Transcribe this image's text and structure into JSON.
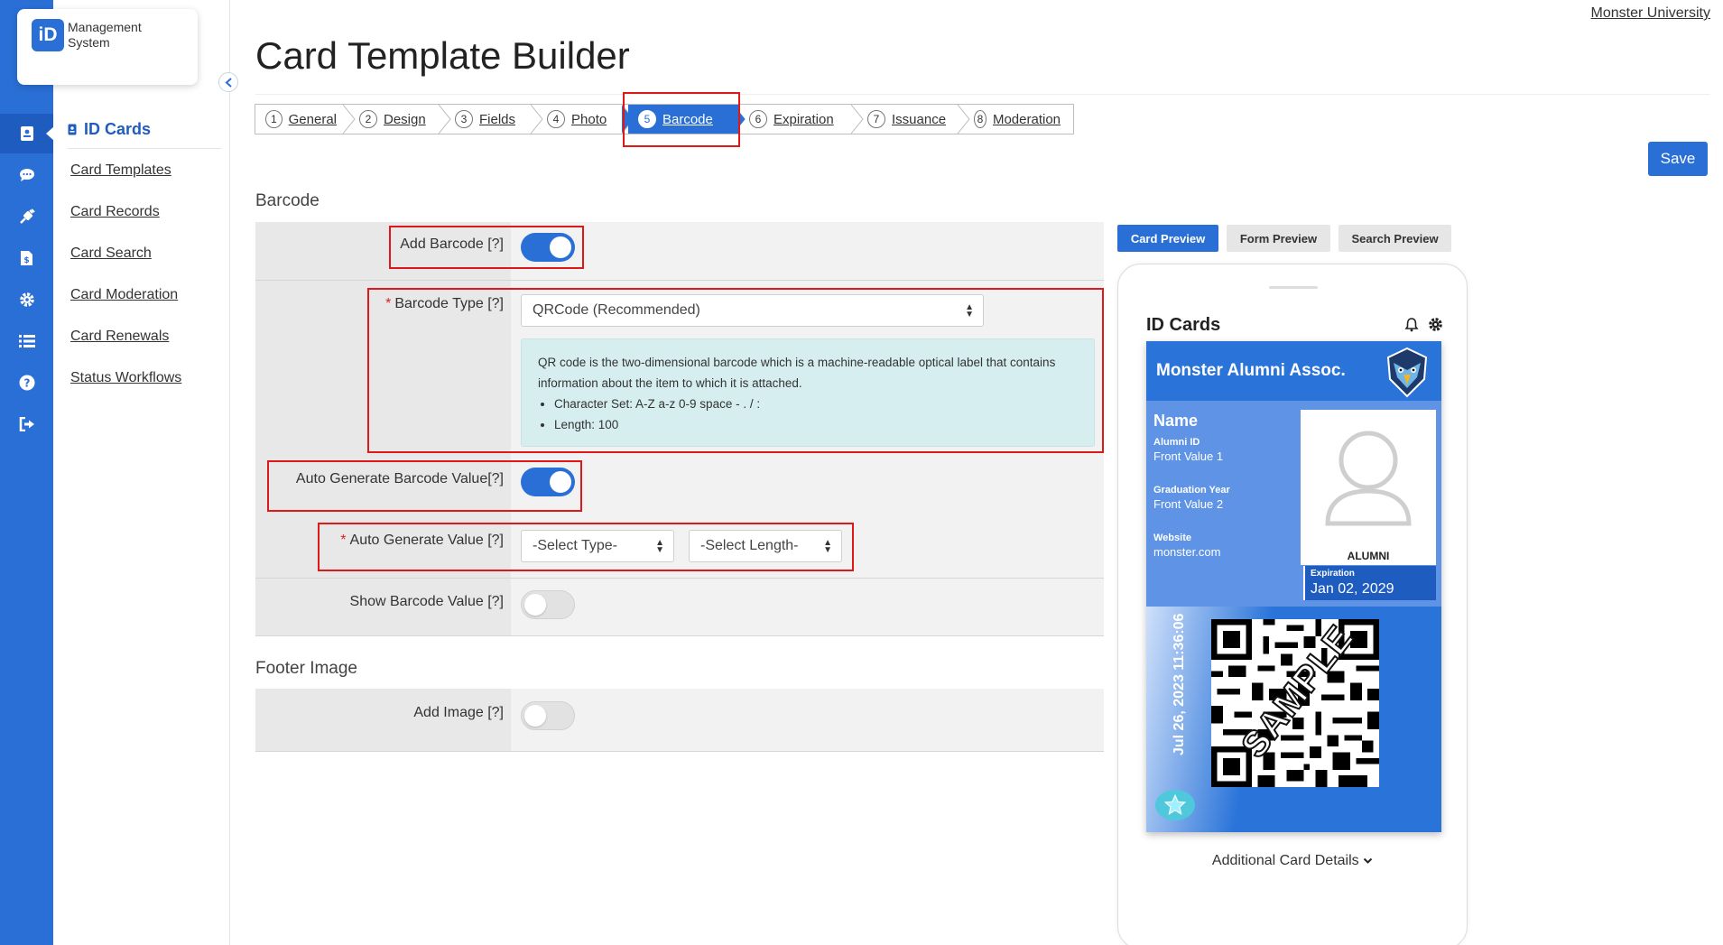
{
  "app": {
    "logo_mark": "iD",
    "logo_line1": "Management",
    "logo_line2": "System",
    "org_link": "Monster University"
  },
  "icons": {
    "rail": [
      "id-card-icon",
      "chat-icon",
      "plug-icon",
      "invoice-icon",
      "gear-icon",
      "list-icon",
      "help-icon",
      "logout-icon"
    ],
    "collapse": "chevron-left-icon"
  },
  "sidebar": {
    "heading": "ID Cards",
    "items": [
      {
        "label": "Card Templates"
      },
      {
        "label": "Card Records"
      },
      {
        "label": "Card Search"
      },
      {
        "label": "Card Moderation"
      },
      {
        "label": "Card Renewals"
      },
      {
        "label": "Status Workflows"
      }
    ]
  },
  "page": {
    "title": "Card Template Builder",
    "save_label": "Save"
  },
  "steps": [
    {
      "num": "1",
      "label": "General",
      "active": false
    },
    {
      "num": "2",
      "label": "Design",
      "active": false
    },
    {
      "num": "3",
      "label": "Fields",
      "active": false
    },
    {
      "num": "4",
      "label": "Photo",
      "active": false
    },
    {
      "num": "5",
      "label": "Barcode",
      "active": true
    },
    {
      "num": "6",
      "label": "Expiration",
      "active": false
    },
    {
      "num": "7",
      "label": "Issuance",
      "active": false
    },
    {
      "num": "8",
      "label": "Moderation",
      "active": false
    }
  ],
  "barcode": {
    "section_title": "Barcode",
    "add_barcode_label": "Add Barcode [?]",
    "add_barcode_on": true,
    "type_label": "Barcode Type [?]",
    "type_value": "QRCode (Recommended)",
    "info_text": "QR code is the two-dimensional barcode which is a machine-readable optical label that contains information about the item to which it is attached.",
    "info_charset": "Character Set: A-Z a-z 0-9 space - . / :",
    "info_length": "Length: 100",
    "auto_generate_label": "Auto Generate Barcode Value[?]",
    "auto_generate_on": true,
    "auto_value_label": "Auto Generate Value [?]",
    "select_type": "-Select Type-",
    "select_length": "-Select Length-",
    "show_value_label": "Show Barcode Value [?]",
    "show_value_on": false
  },
  "footer_image": {
    "section_title": "Footer Image",
    "add_image_label": "Add Image [?]",
    "add_image_on": false
  },
  "preview": {
    "tabs": [
      {
        "label": "Card Preview",
        "active": true
      },
      {
        "label": "Form Preview",
        "active": false
      },
      {
        "label": "Search Preview",
        "active": false
      }
    ],
    "phone_title": "ID Cards",
    "card": {
      "org_name": "Monster Alumni Assoc.",
      "name_label": "Name",
      "field1_label": "Alumni ID",
      "field1_value": "Front Value 1",
      "field2_label": "Graduation Year",
      "field2_value": "Front Value 2",
      "field3_label": "Website",
      "field3_value": "monster.com",
      "role": "ALUMNI",
      "expiration_label": "Expiration",
      "expiration_value": "Jan 02, 2029",
      "timestamp": "Jul 26, 2023   11:36:06",
      "watermark": "SAMPLE"
    },
    "more_details": "Additional Card Details"
  }
}
